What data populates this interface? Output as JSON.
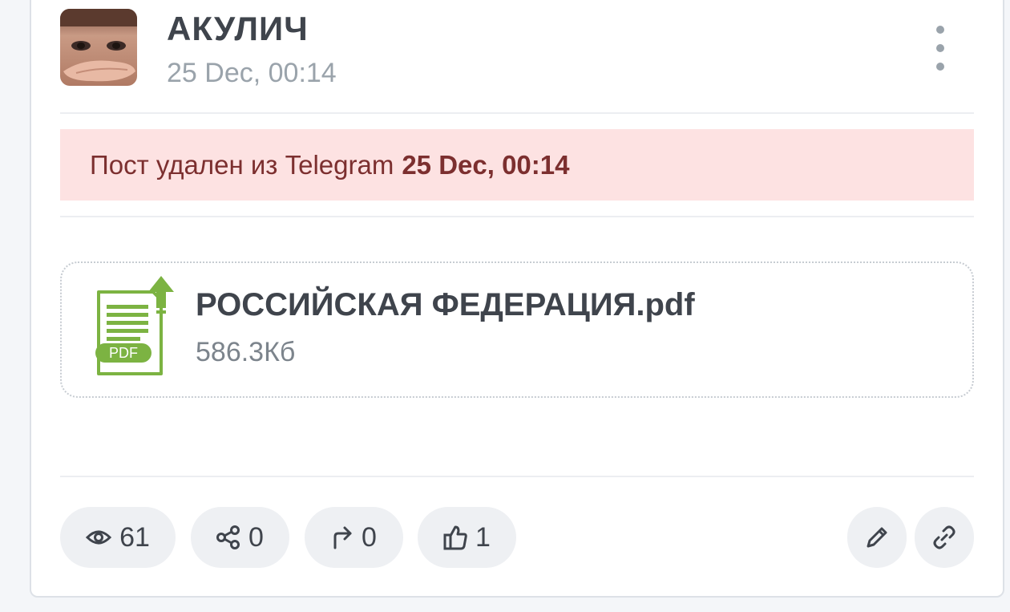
{
  "post": {
    "author": "АКУЛИЧ",
    "date": "25 Dec, 00:14"
  },
  "alert": {
    "text": "Пост удален из Telegram",
    "date": "25 Dec, 00:14",
    "background": "#fde2e2",
    "text_color": "#7c2f2f"
  },
  "attachment": {
    "icon": "pdf-file-icon",
    "badge": "PDF",
    "name": "РОССИЙСКАЯ ФЕДЕРАЦИЯ.pdf",
    "size": "586.3Кб",
    "accent": "#7cb342"
  },
  "stats": {
    "views": {
      "icon": "eye-icon",
      "value": "61"
    },
    "shares": {
      "icon": "share-icon",
      "value": "0"
    },
    "forwards": {
      "icon": "forward-icon",
      "value": "0"
    },
    "likes": {
      "icon": "thumbs-up-icon",
      "value": "1"
    }
  },
  "actions": {
    "edit": {
      "icon": "pencil-icon"
    },
    "link": {
      "icon": "link-icon"
    }
  },
  "menu": {
    "icon": "more-vertical-icon"
  }
}
